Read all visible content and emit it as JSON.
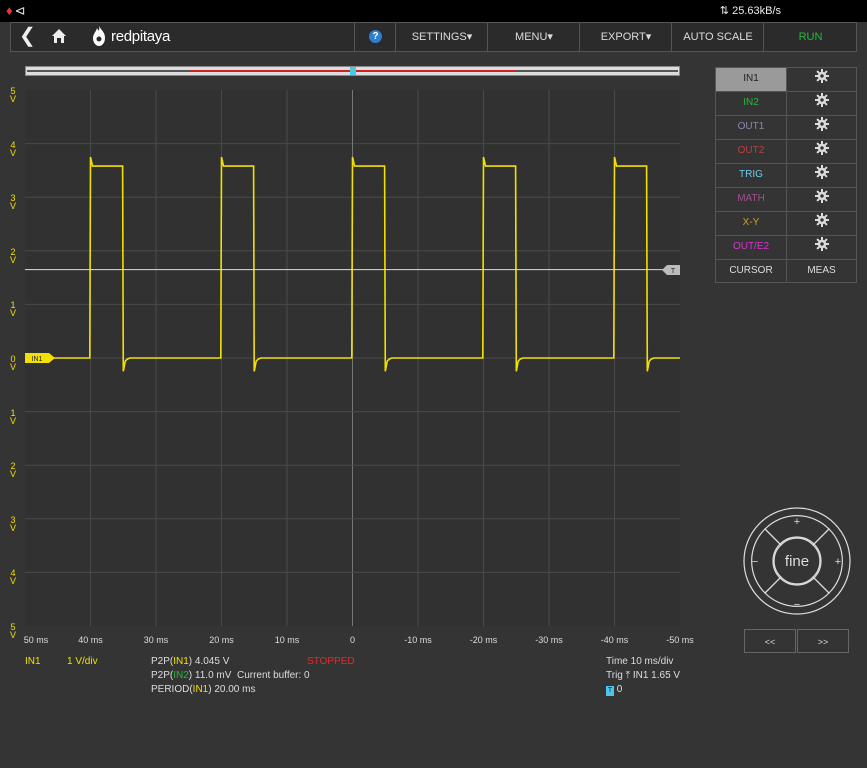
{
  "statusbar": {
    "rate": "25.63kB/s"
  },
  "nav": {
    "logo": "redpitaya",
    "help": "?",
    "settings": "SETTINGS",
    "menu": "MENU",
    "export": "EXPORT",
    "autoscale": "AUTO SCALE",
    "run": "RUN"
  },
  "trigger_label": "T",
  "y_ticks": [
    {
      "num": "5",
      "unit": "V"
    },
    {
      "num": "4",
      "unit": "V"
    },
    {
      "num": "3",
      "unit": "V"
    },
    {
      "num": "2",
      "unit": "V"
    },
    {
      "num": "1",
      "unit": "V"
    },
    {
      "num": "0",
      "unit": "V"
    },
    {
      "num": "1",
      "unit": "V"
    },
    {
      "num": "2",
      "unit": "V"
    },
    {
      "num": "3",
      "unit": "V"
    },
    {
      "num": "4",
      "unit": "V"
    },
    {
      "num": "5",
      "unit": "V"
    }
  ],
  "x_ticks": [
    "50 ms",
    "40 ms",
    "30 ms",
    "20 ms",
    "10 ms",
    "0",
    "-10 ms",
    "-20 ms",
    "-30 ms",
    "-40 ms",
    "-50 ms"
  ],
  "channel_marker": "IN1",
  "trig_level_marker": "T",
  "channels": [
    {
      "name": "IN1",
      "color": "#222222",
      "selected": true
    },
    {
      "name": "IN2",
      "color": "#27b83a"
    },
    {
      "name": "OUT1",
      "color": "#8a8aa8"
    },
    {
      "name": "OUT2",
      "color": "#b84040"
    },
    {
      "name": "TRIG",
      "color": "#6ad0ee"
    },
    {
      "name": "MATH",
      "color": "#a0508a"
    },
    {
      "name": "X-Y",
      "color": "#d0a030"
    },
    {
      "name": "OUT/E2",
      "color": "#e030d8"
    }
  ],
  "cursor": "CURSOR",
  "meas": "MEAS",
  "joystick": {
    "center": "fine",
    "plus": "+",
    "minus": "−"
  },
  "page_prev": "<<",
  "page_next": ">>",
  "info": {
    "ch": "IN1",
    "scale": "1 V/div",
    "p2p_label": "P2P(",
    "in1": "IN1",
    "in2": "IN2",
    "p2p1_val": ") 4.045 V",
    "p2p2_val": ") 11.0 mV",
    "buffer": "Current buffer: 0",
    "period_label": "PERIOD(",
    "period_val": ") 20.00 ms",
    "status": "STOPPED",
    "time": "Time 10 ms/div",
    "trig_prefix": "Trig",
    "trig_val": "IN1 1.65 V",
    "trig_pos": "0"
  },
  "chart_data": {
    "type": "line",
    "xlabel": "",
    "ylabel": "",
    "xlim": [
      50,
      -50
    ],
    "ylim": [
      -5,
      5
    ],
    "grid": true,
    "series": [
      {
        "color": "#f2e000",
        "x": [
          50,
          40.1,
          40,
          39.7,
          39.4,
          35.1,
          35,
          34.7,
          34.4,
          34,
          30,
          20.1,
          20,
          19.7,
          19.4,
          15.1,
          15,
          14.7,
          14.4,
          14,
          10,
          0.1,
          0,
          -0.3,
          -0.6,
          -4.9,
          -5,
          -5.3,
          -5.6,
          -6,
          -10,
          -19.9,
          -20,
          -20.3,
          -20.6,
          -24.9,
          -25,
          -25.3,
          -25.6,
          -26,
          -30,
          -39.9,
          -40,
          -40.3,
          -40.6,
          -44.9,
          -45,
          -45.3,
          -45.6,
          -46,
          -50
        ],
        "y": [
          0,
          0,
          3.75,
          3.58,
          3.58,
          3.58,
          -0.25,
          -0.06,
          -0.02,
          0,
          0,
          0,
          3.75,
          3.58,
          3.58,
          3.58,
          -0.25,
          -0.06,
          -0.02,
          0,
          0,
          0,
          3.75,
          3.58,
          3.58,
          3.58,
          -0.25,
          -0.06,
          -0.02,
          0,
          0,
          0,
          3.75,
          3.58,
          3.58,
          3.58,
          -0.25,
          -0.06,
          -0.02,
          0,
          0,
          0,
          3.75,
          3.58,
          3.58,
          3.58,
          -0.25,
          -0.06,
          -0.02,
          0,
          0
        ]
      },
      {
        "color": "#dddddd",
        "x": [
          50,
          -50
        ],
        "y": [
          1.65,
          1.65
        ]
      }
    ]
  }
}
